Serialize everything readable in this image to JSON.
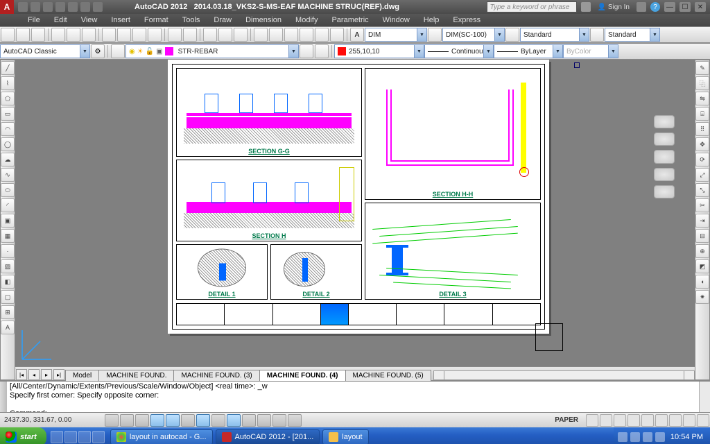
{
  "title": {
    "app": "AutoCAD 2012",
    "file": "2014.03.18_VKS2-S-MS-EAF MACHINE STRUC(REF).dwg"
  },
  "search": {
    "placeholder": "Type a keyword or phrase"
  },
  "signin": {
    "label": "Sign In"
  },
  "menu": [
    "File",
    "Edit",
    "View",
    "Insert",
    "Format",
    "Tools",
    "Draw",
    "Dimension",
    "Modify",
    "Parametric",
    "Window",
    "Help",
    "Express"
  ],
  "row1": {
    "dimstyle": "DIM",
    "dimscale": "DIM(SC-100)",
    "tablestyle_a": "Standard",
    "tablestyle_b": "Standard"
  },
  "row2": {
    "workspace": "AutoCAD Classic",
    "layer": "STR-REBAR",
    "color_code": "255,10,10",
    "linetype": "Continuous",
    "lineweight": "ByLayer",
    "plotstyle": "ByColor"
  },
  "viewports": {
    "gg": "SECTION G-G",
    "hh": "SECTION H-H",
    "h": "SECTION H",
    "d1": "DETAIL 1",
    "d2": "DETAIL 2",
    "d3": "DETAIL 3"
  },
  "layout_tabs": [
    "Model",
    "MACHINE FOUND.",
    "MACHINE FOUND. (3)",
    "MACHINE FOUND. (4)",
    "MACHINE FOUND. (5)"
  ],
  "layout_active_index": 3,
  "command": {
    "line1": "[All/Center/Dynamic/Extents/Previous/Scale/Window/Object] <real time>: _w",
    "line2": "Specify first corner: Specify opposite corner:",
    "prompt": "Command:"
  },
  "status": {
    "coords": "2437.30, 331.67, 0.00",
    "space": "PAPER"
  },
  "taskbar": {
    "start": "start",
    "items": [
      "layout in autocad - G...",
      "AutoCAD 2012 - [201...",
      "layout"
    ],
    "active_index": 1,
    "clock": "10:54 PM"
  }
}
